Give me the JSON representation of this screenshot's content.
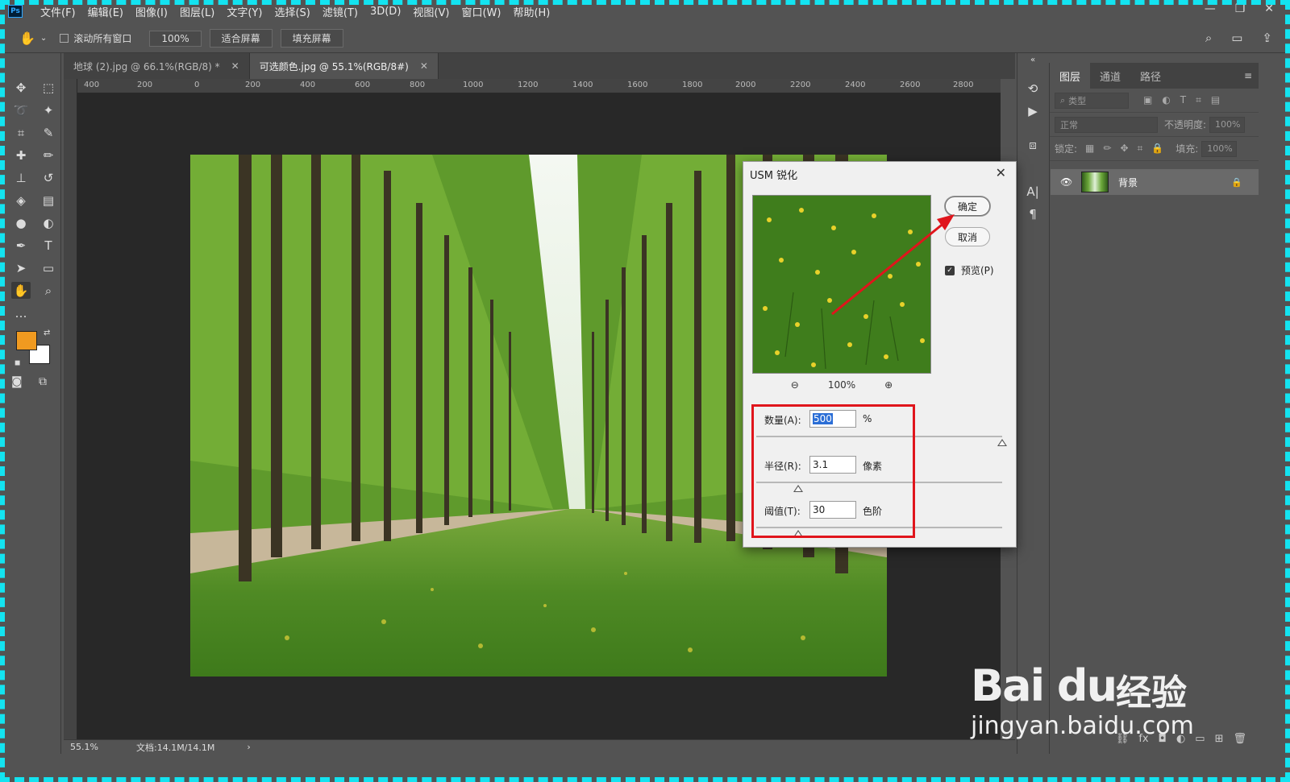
{
  "menubar": {
    "logo": "Ps",
    "items": [
      "文件(F)",
      "编辑(E)",
      "图像(I)",
      "图层(L)",
      "文字(Y)",
      "选择(S)",
      "滤镜(T)",
      "3D(D)",
      "视图(V)",
      "窗口(W)",
      "帮助(H)"
    ]
  },
  "options": {
    "scroll_all_label": "滚动所有窗口",
    "zoom_value": "100%",
    "fit_screen": "适合屏幕",
    "fill_screen": "填充屏幕"
  },
  "tabs": [
    {
      "label": "地球 (2).jpg @ 66.1%(RGB/8) *"
    },
    {
      "label": "可选颜色.jpg @ 55.1%(RGB/8#)"
    }
  ],
  "ruler": {
    "top_ticks": [
      "400",
      "200",
      "0",
      "200",
      "400",
      "600",
      "800",
      "1000",
      "1200",
      "1400",
      "1600",
      "1800",
      "2000",
      "2200",
      "2400",
      "2600",
      "2800"
    ]
  },
  "status": {
    "zoom": "55.1%",
    "doc": "文档:14.1M/14.1M",
    "arrow": "›"
  },
  "layers_panel": {
    "tabs": [
      "图层",
      "通道",
      "路径"
    ],
    "filter_kind": "类型",
    "blend_mode": "正常",
    "opacity_label": "不透明度:",
    "opacity_value": "100%",
    "lock_label": "锁定:",
    "fill_label": "填充:",
    "fill_value": "100%",
    "layer_name": "背景"
  },
  "dialog": {
    "title": "USM 锐化",
    "ok": "确定",
    "cancel": "取消",
    "preview_label": "预览(P)",
    "zoom_level": "100%",
    "amount_label": "数量(A):",
    "amount_value": "500",
    "amount_unit": "%",
    "amount_level": 1.0,
    "radius_label": "半径(R):",
    "radius_value": "3.1",
    "radius_unit": "像素",
    "threshold_label": "阈值(T):",
    "threshold_value": "30",
    "threshold_unit": "色阶"
  },
  "watermark": {
    "logo": "Bai du",
    "cn": "经验",
    "url": "jingyan.baidu.com"
  },
  "colors": {
    "foreground": "#f09a20",
    "background": "#ffffff",
    "highlight": "#e0151c",
    "frame": "#13e3f0"
  }
}
